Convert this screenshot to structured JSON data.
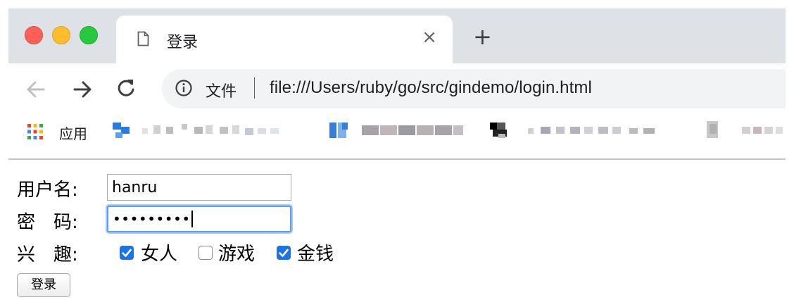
{
  "browser": {
    "tab": {
      "title": "登录",
      "close": "×"
    },
    "new_tab": "+",
    "address": {
      "scheme_label": "文件",
      "url": "file:///Users/ruby/go/src/gindemo/login.html"
    },
    "bookmarks": {
      "apps_label": "应用"
    }
  },
  "form": {
    "username_label": "用户名:",
    "username_value": "hanru",
    "password_label": "密　码:",
    "password_value": "•••••••••",
    "hobby_label": "兴　趣:",
    "hobbies": [
      {
        "label": "女人",
        "checked": true
      },
      {
        "label": "游戏",
        "checked": false
      },
      {
        "label": "金钱",
        "checked": true
      }
    ],
    "submit_label": "登录"
  },
  "colors": {
    "accent": "#1a73e8",
    "focus": "#5b9df5"
  }
}
